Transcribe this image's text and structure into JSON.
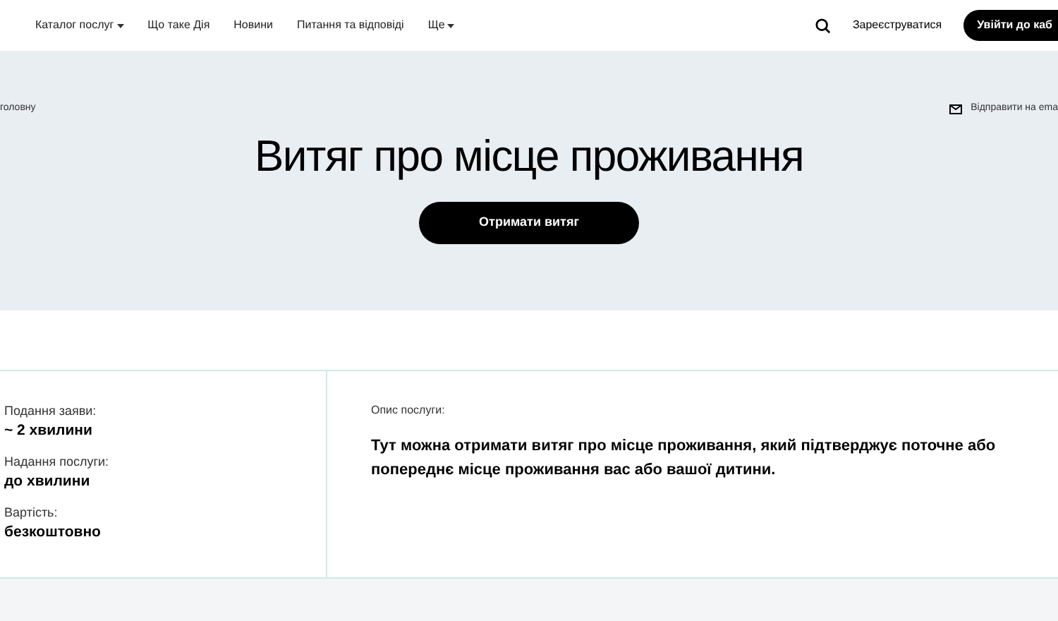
{
  "header": {
    "nav": [
      {
        "label": "Каталог послуг",
        "has_menu": true
      },
      {
        "label": "Що таке Дія",
        "has_menu": false
      },
      {
        "label": "Новини",
        "has_menu": false
      },
      {
        "label": "Питання та відповіді",
        "has_menu": false
      },
      {
        "label": "Ще",
        "has_menu": true
      }
    ],
    "register_link": "Зареєструватися",
    "login_button": "Увійти до каб"
  },
  "hero": {
    "breadcrumb": "головну",
    "email_link": "Відправити на ema",
    "title": "Витяг про місце проживання",
    "action_button": "Отримати витяг"
  },
  "details": {
    "facts": [
      {
        "label": "Подання заяви:",
        "value": "~ 2 хвилини"
      },
      {
        "label": "Надання послуги:",
        "value": "до хвилини"
      },
      {
        "label": "Вартість:",
        "value": "безкоштовно"
      }
    ],
    "description_label": "Опис послуги:",
    "description": "Тут можна отримати витяг про місце проживання, який підтверджує поточне або попереднє місце проживання вас або вашої дитини."
  }
}
